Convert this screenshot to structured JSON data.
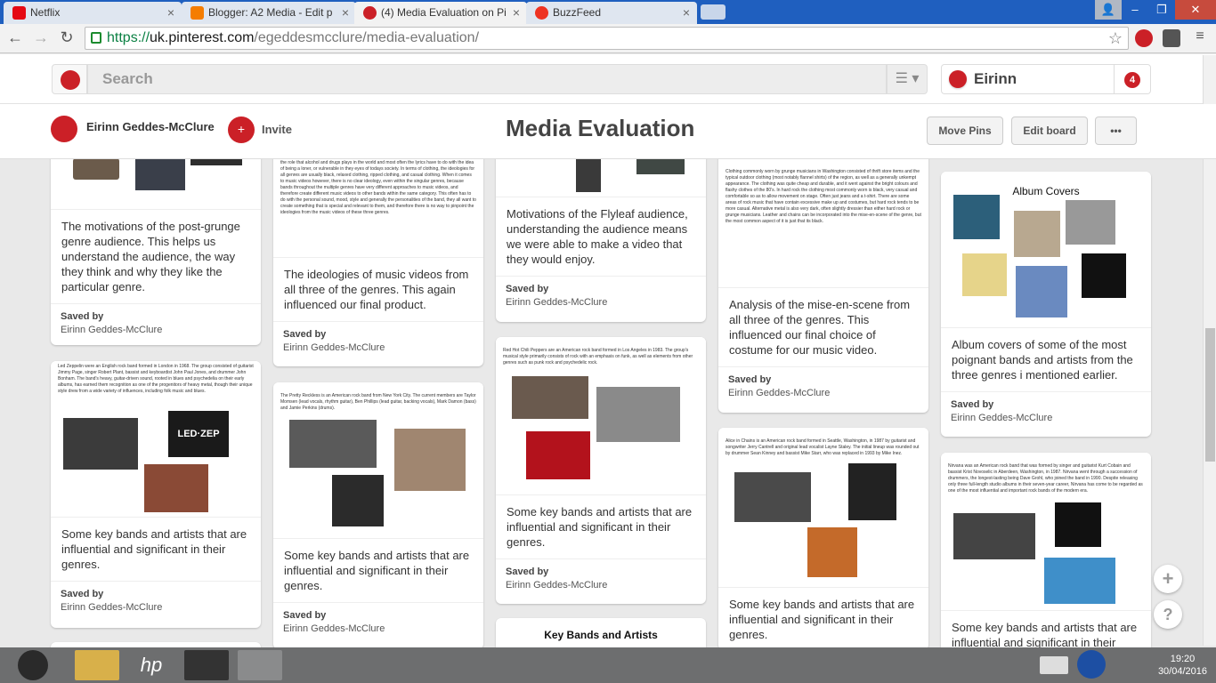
{
  "tabs": [
    {
      "label": "Netflix",
      "color": "#e50914"
    },
    {
      "label": "Blogger: A2 Media - Edit p",
      "color": "#f57d00"
    },
    {
      "label": "(4) Media Evaluation on Pi",
      "color": "#cb2027"
    },
    {
      "label": "BuzzFeed",
      "color": "#ee3322"
    }
  ],
  "address": {
    "https": "https://",
    "host": "uk.pinterest.com",
    "path": "/egeddesmcclure/media-evaluation/"
  },
  "header": {
    "search_placeholder": "Search",
    "user_name": "Eirinn",
    "notifications": "4"
  },
  "board": {
    "owner": "Eirinn Geddes-McClure",
    "invite": "Invite",
    "title": "Media Evaluation",
    "move_pins": "Move Pins",
    "edit_board": "Edit board",
    "more": "•••"
  },
  "saved_by": "Saved by",
  "saved_name": "Eirinn Geddes-McClure",
  "pins": {
    "p1": {
      "desc": "The motivations of the post-grunge genre audience. This helps us understand the audience, the way they think and why they like the particular genre."
    },
    "p2": {
      "text": "the role that alcohol and drugs plays in the world and most often the lyrics have to do with the idea of being a loner, or vulnerable in they eyes of todays society. In terms of clothing, the ideologies for all genres are usually black, relaxed clothing, ripped clothing, and casual clothing. When it comes to music videos however, there is no clear ideology, even within the singular genres, because bands throughout the multiple genres have very different approaches to music videos, and therefore create different music videos to other bands within the same category. This often has to do with the personal sound, mood, style and generally the personalities of the band, they all want to create something that is special and relevant to them, and therefore there is no way to pinpoint the ideologies from the music videos of these three genres.",
      "desc": "The ideologies of music videos from all three of the genres. This again influenced our final product."
    },
    "p3": {
      "desc": "Motivations of the Flyleaf audience, understanding the audience means we were able to make a video that they would enjoy."
    },
    "p4": {
      "text": "Clothing commonly worn by grunge musicians in Washington consisted of thrift store items and the typical outdoor clothing (most notably flannel shirts) of the region, as well as a generally unkempt appearance. The clothing was quite cheap and durable, and it went against the bright colours and flashy clothes of the 80's. In hard rock the clothing most commonly worn is black, very casual and comfortable so as to allow movement on stage. Often just jeans and a t-shirt. There are some areas of rock music that have contain excessive make up and costumes, but hard rock tends to be more casual. Alternative metal is also very dark, often slightly dressier than either hard rock or grunge musicians. Leather and chains can be incorporated into the mise-en-scene of the genre, but the most common aspect of it is just that its black.",
      "desc": "Analysis of the mise-en-scene from all three of the genres. This influenced our final choice of costume for our music video."
    },
    "p5": {
      "caption": "Album Covers",
      "desc": "Album covers of some of the most poignant bands and artists from the three genres i mentioned earlier."
    },
    "p6": {
      "text": "Led Zeppelin were an English rock band formed in London in 1968. The group consisted of guitarist Jimmy Page, singer Robert Plant, bassist and keyboardist John Paul Jones, and drummer John Bonham. The band's heavy, guitar-driven sound, rooted in blues and psychedelia on their early albums, has earned them recognition as one of the progenitors of heavy metal, though their unique style drew from a wide variety of influences, including folk music and blues.",
      "desc": "Some key bands and artists that are influential and significant in their genres."
    },
    "p7": {
      "text": "The Pretty Reckless is an American rock band from New York City. The current members are Taylor Momsen (lead vocals, rhythm guitar), Ben Phillips (lead guitar, backing vocals), Mark Damon (bass) and Jamie Perkins (drums).",
      "desc": "Some key bands and artists that are influential and significant in their genres."
    },
    "p8": {
      "text": "Red Hot Chili Peppers are an American rock band formed in Los Angeles in 1983. The group's musical style primarily consists of rock with an emphasis on funk, as well as elements from other genres such as punk rock and psychedelic rock.",
      "desc": "Some key bands and artists that are influential and significant in their genres."
    },
    "p9": {
      "text": "Alice in Chains is an American rock band formed in Seattle, Washington, in 1987 by guitarist and songwriter Jerry Cantrell and original lead vocalist Layne Staley. The initial lineup was rounded out by drummer Sean Kinney and bassist Mike Starr, who was replaced in 1993 by Mike Inez.",
      "desc": "Some key bands and artists that are influential and significant in their genres."
    },
    "p10": {
      "text": "Nirvana was an American rock band that was formed by singer and guitarist Kurt Cobain and bassist Krist Novoselic in Aberdeen, Washington, in 1987. Nirvana went through a succession of drummers, the longest-lasting being Dave Grohl, who joined the band in 1990. Despite releasing only three full-length studio albums in their seven-year career, Nirvana has come to be regarded as one of the most influential and important rock bands of the modern era.",
      "desc": "Some key bands and artists that are influential and significant in their"
    },
    "p11": {
      "caption": "Key Bands and Artists"
    }
  },
  "fabs": {
    "plus": "+",
    "help": "?"
  },
  "taskbar": {
    "time": "19:20",
    "date": "30/04/2016",
    "hp": "hp"
  }
}
